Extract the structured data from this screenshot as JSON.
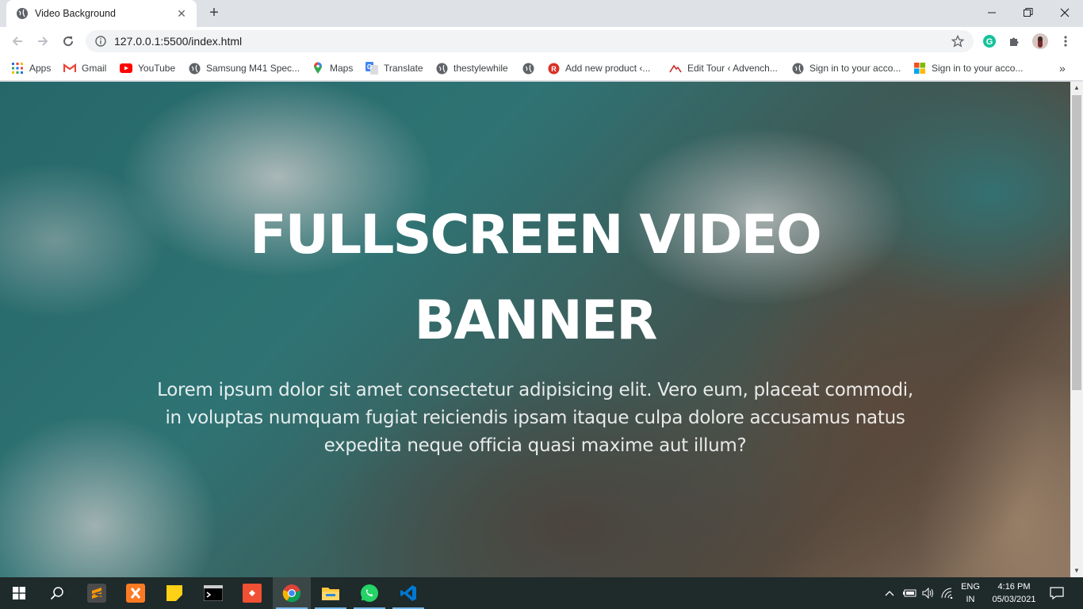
{
  "browser": {
    "tab_title": "Video Background",
    "url": "127.0.0.1:5500/index.html"
  },
  "bookmarks": [
    {
      "label": "Apps",
      "icon": "apps-grid-icon"
    },
    {
      "label": "Gmail",
      "icon": "gmail-icon"
    },
    {
      "label": "YouTube",
      "icon": "youtube-icon"
    },
    {
      "label": "Samsung M41 Spec...",
      "icon": "globe-icon"
    },
    {
      "label": "Maps",
      "icon": "maps-icon"
    },
    {
      "label": "Translate",
      "icon": "translate-icon"
    },
    {
      "label": "thestylewhile",
      "icon": "globe-icon"
    },
    {
      "label": "",
      "icon": "globe-icon"
    },
    {
      "label": "Add new product ‹...",
      "icon": "red-r-icon"
    },
    {
      "label": "Edit Tour ‹ Advench...",
      "icon": "mountain-icon"
    },
    {
      "label": "Sign in to your acco...",
      "icon": "globe-icon"
    },
    {
      "label": "Sign in to your acco...",
      "icon": "microsoft-icon"
    }
  ],
  "page": {
    "title_line1": "FULLSCREEN VIDEO",
    "title_line2": "BANNER",
    "paragraph_line1": "Lorem ipsum dolor sit amet consectetur adipisicing elit. Vero eum, placeat commodi,",
    "paragraph_line2": "in voluptas numquam fugiat reiciendis ipsam itaque culpa dolore accusamus natus",
    "paragraph_line3": "expedita neque officia quasi maxime aut illum?"
  },
  "taskbar": {
    "language_line1": "ENG",
    "language_line2": "IN",
    "time": "4:16 PM",
    "date": "05/03/2021"
  }
}
